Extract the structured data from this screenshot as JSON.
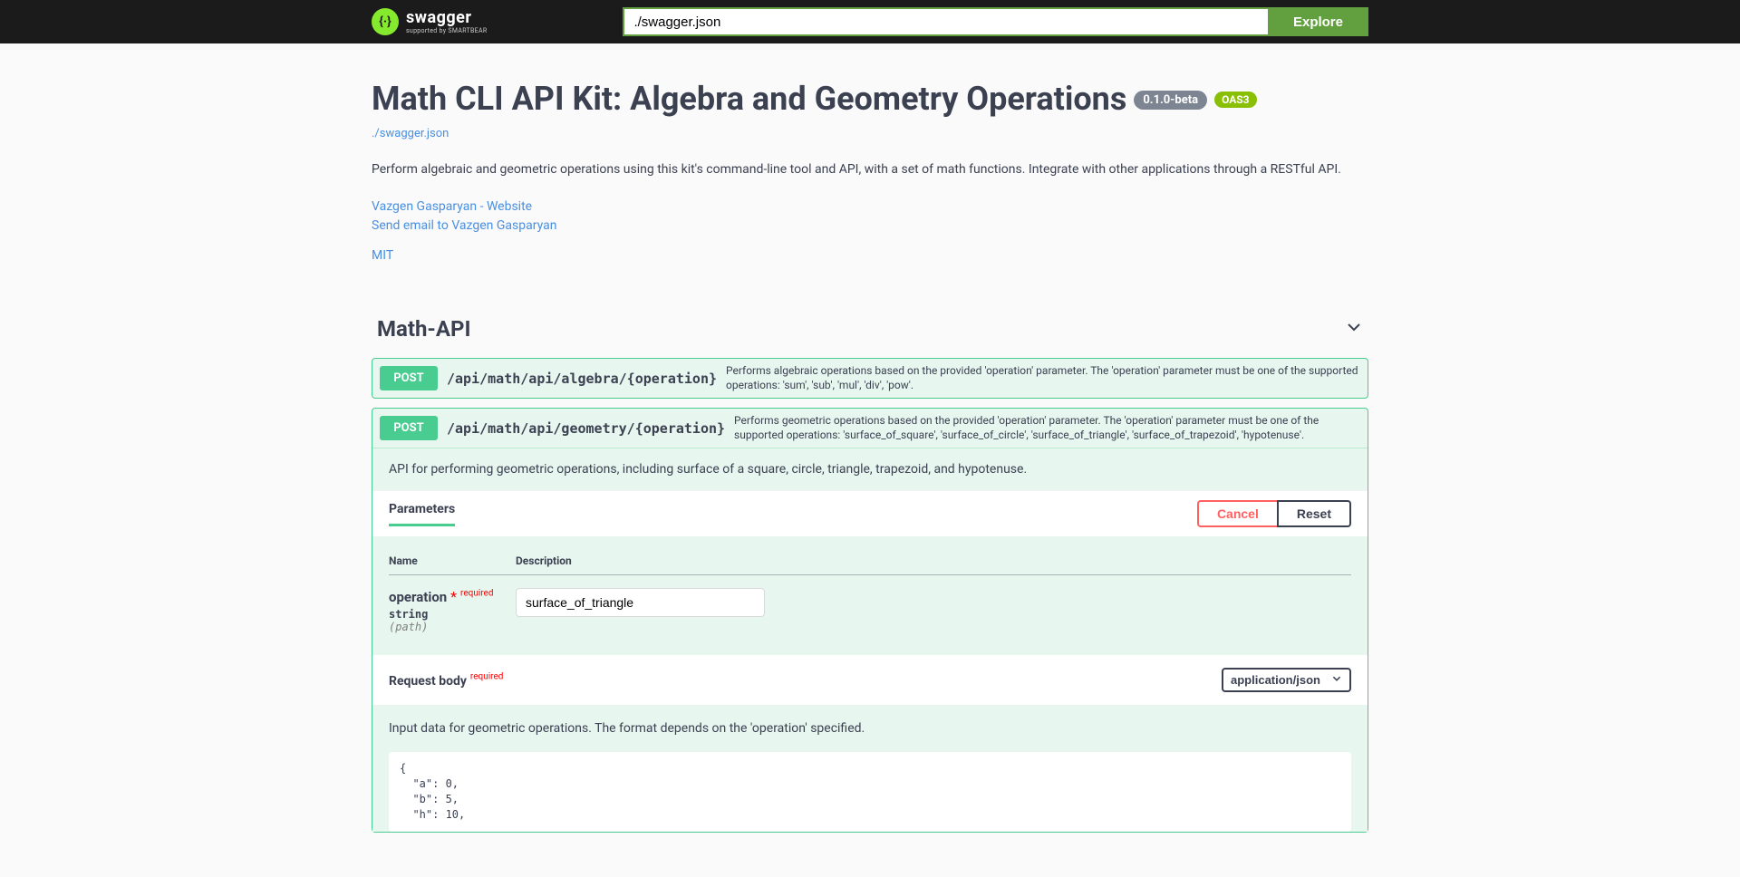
{
  "topbar": {
    "logo_main": "swagger",
    "logo_sub": "supported by SMARTBEAR",
    "url_value": "./swagger.json",
    "explore_label": "Explore"
  },
  "info": {
    "title": "Math CLI API Kit: Algebra and Geometry Operations",
    "version": "0.1.0-beta",
    "oas": "OAS3",
    "spec_url": "./swagger.json",
    "description": "Perform algebraic and geometric operations using this kit's command-line tool and API, with a set of math functions. Integrate with other applications through a RESTful API.",
    "contact_site": "Vazgen Gasparyan - Website",
    "contact_email": "Send email to Vazgen Gasparyan",
    "license": "MIT"
  },
  "tag": {
    "name": "Math-API"
  },
  "op1": {
    "method": "POST",
    "path": "/api/math/api/algebra/{operation}",
    "summary": "Performs algebraic operations based on the provided 'operation' parameter. The 'operation' parameter must be one of the supported operations: 'sum', 'sub', 'mul', 'div', 'pow'."
  },
  "op2": {
    "method": "POST",
    "path": "/api/math/api/geometry/{operation}",
    "summary": "Performs geometric operations based on the provided 'operation' parameter. The 'operation' parameter must be one of the supported operations: 'surface_of_square', 'surface_of_circle', 'surface_of_triangle', 'surface_of_trapezoid', 'hypotenuse'.",
    "description": "API for performing geometric operations, including surface of a square, circle, triangle, trapezoid, and hypotenuse."
  },
  "params": {
    "header_title": "Parameters",
    "cancel_label": "Cancel",
    "reset_label": "Reset",
    "col_name": "Name",
    "col_desc": "Description",
    "p1_name": "operation",
    "p1_required": "required",
    "p1_type": "string",
    "p1_in": "(path)",
    "p1_value": "surface_of_triangle"
  },
  "reqbody": {
    "title": "Request body",
    "required": "required",
    "content_type": "application/json",
    "description": "Input data for geometric operations. The format depends on the 'operation' specified.",
    "example": "{\n  \"a\": 0,\n  \"b\": 5,\n  \"h\": 10,"
  }
}
